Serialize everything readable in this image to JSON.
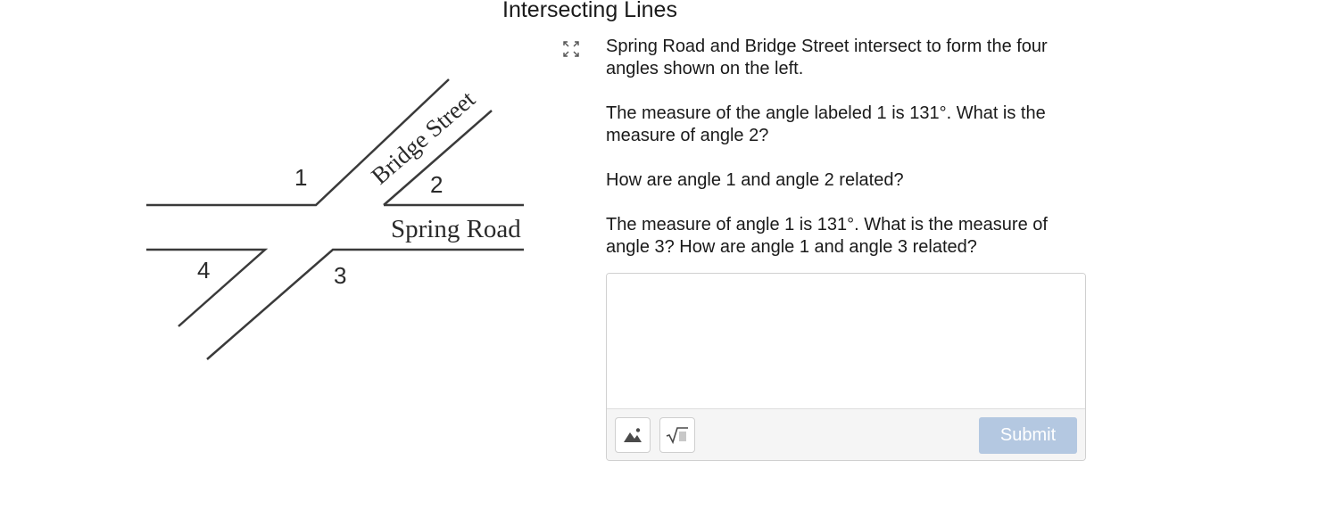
{
  "page": {
    "title": "Intersecting Lines"
  },
  "diagram": {
    "street_label": "Bridge Street",
    "road_label": "Spring Road",
    "angle_labels": [
      "1",
      "2",
      "3",
      "4"
    ]
  },
  "question": {
    "paragraphs": [
      "Spring Road and Bridge Street intersect to form the four angles shown on the left.",
      "The measure of the angle labeled 1 is 131°. What is the measure of angle 2?",
      "How are angle 1 and angle 2 related?",
      "The measure of angle 1 is 131°. What is the measure of angle 3? How are angle 1 and angle 3 related?"
    ]
  },
  "answer": {
    "value": "",
    "placeholder": "",
    "submit_label": "Submit"
  },
  "icons": {
    "expand": "expand-icon",
    "image": "image-icon",
    "math": "square-root-icon"
  },
  "colors": {
    "submit_bg": "#b4c8e1",
    "line": "#3a3a3a"
  }
}
